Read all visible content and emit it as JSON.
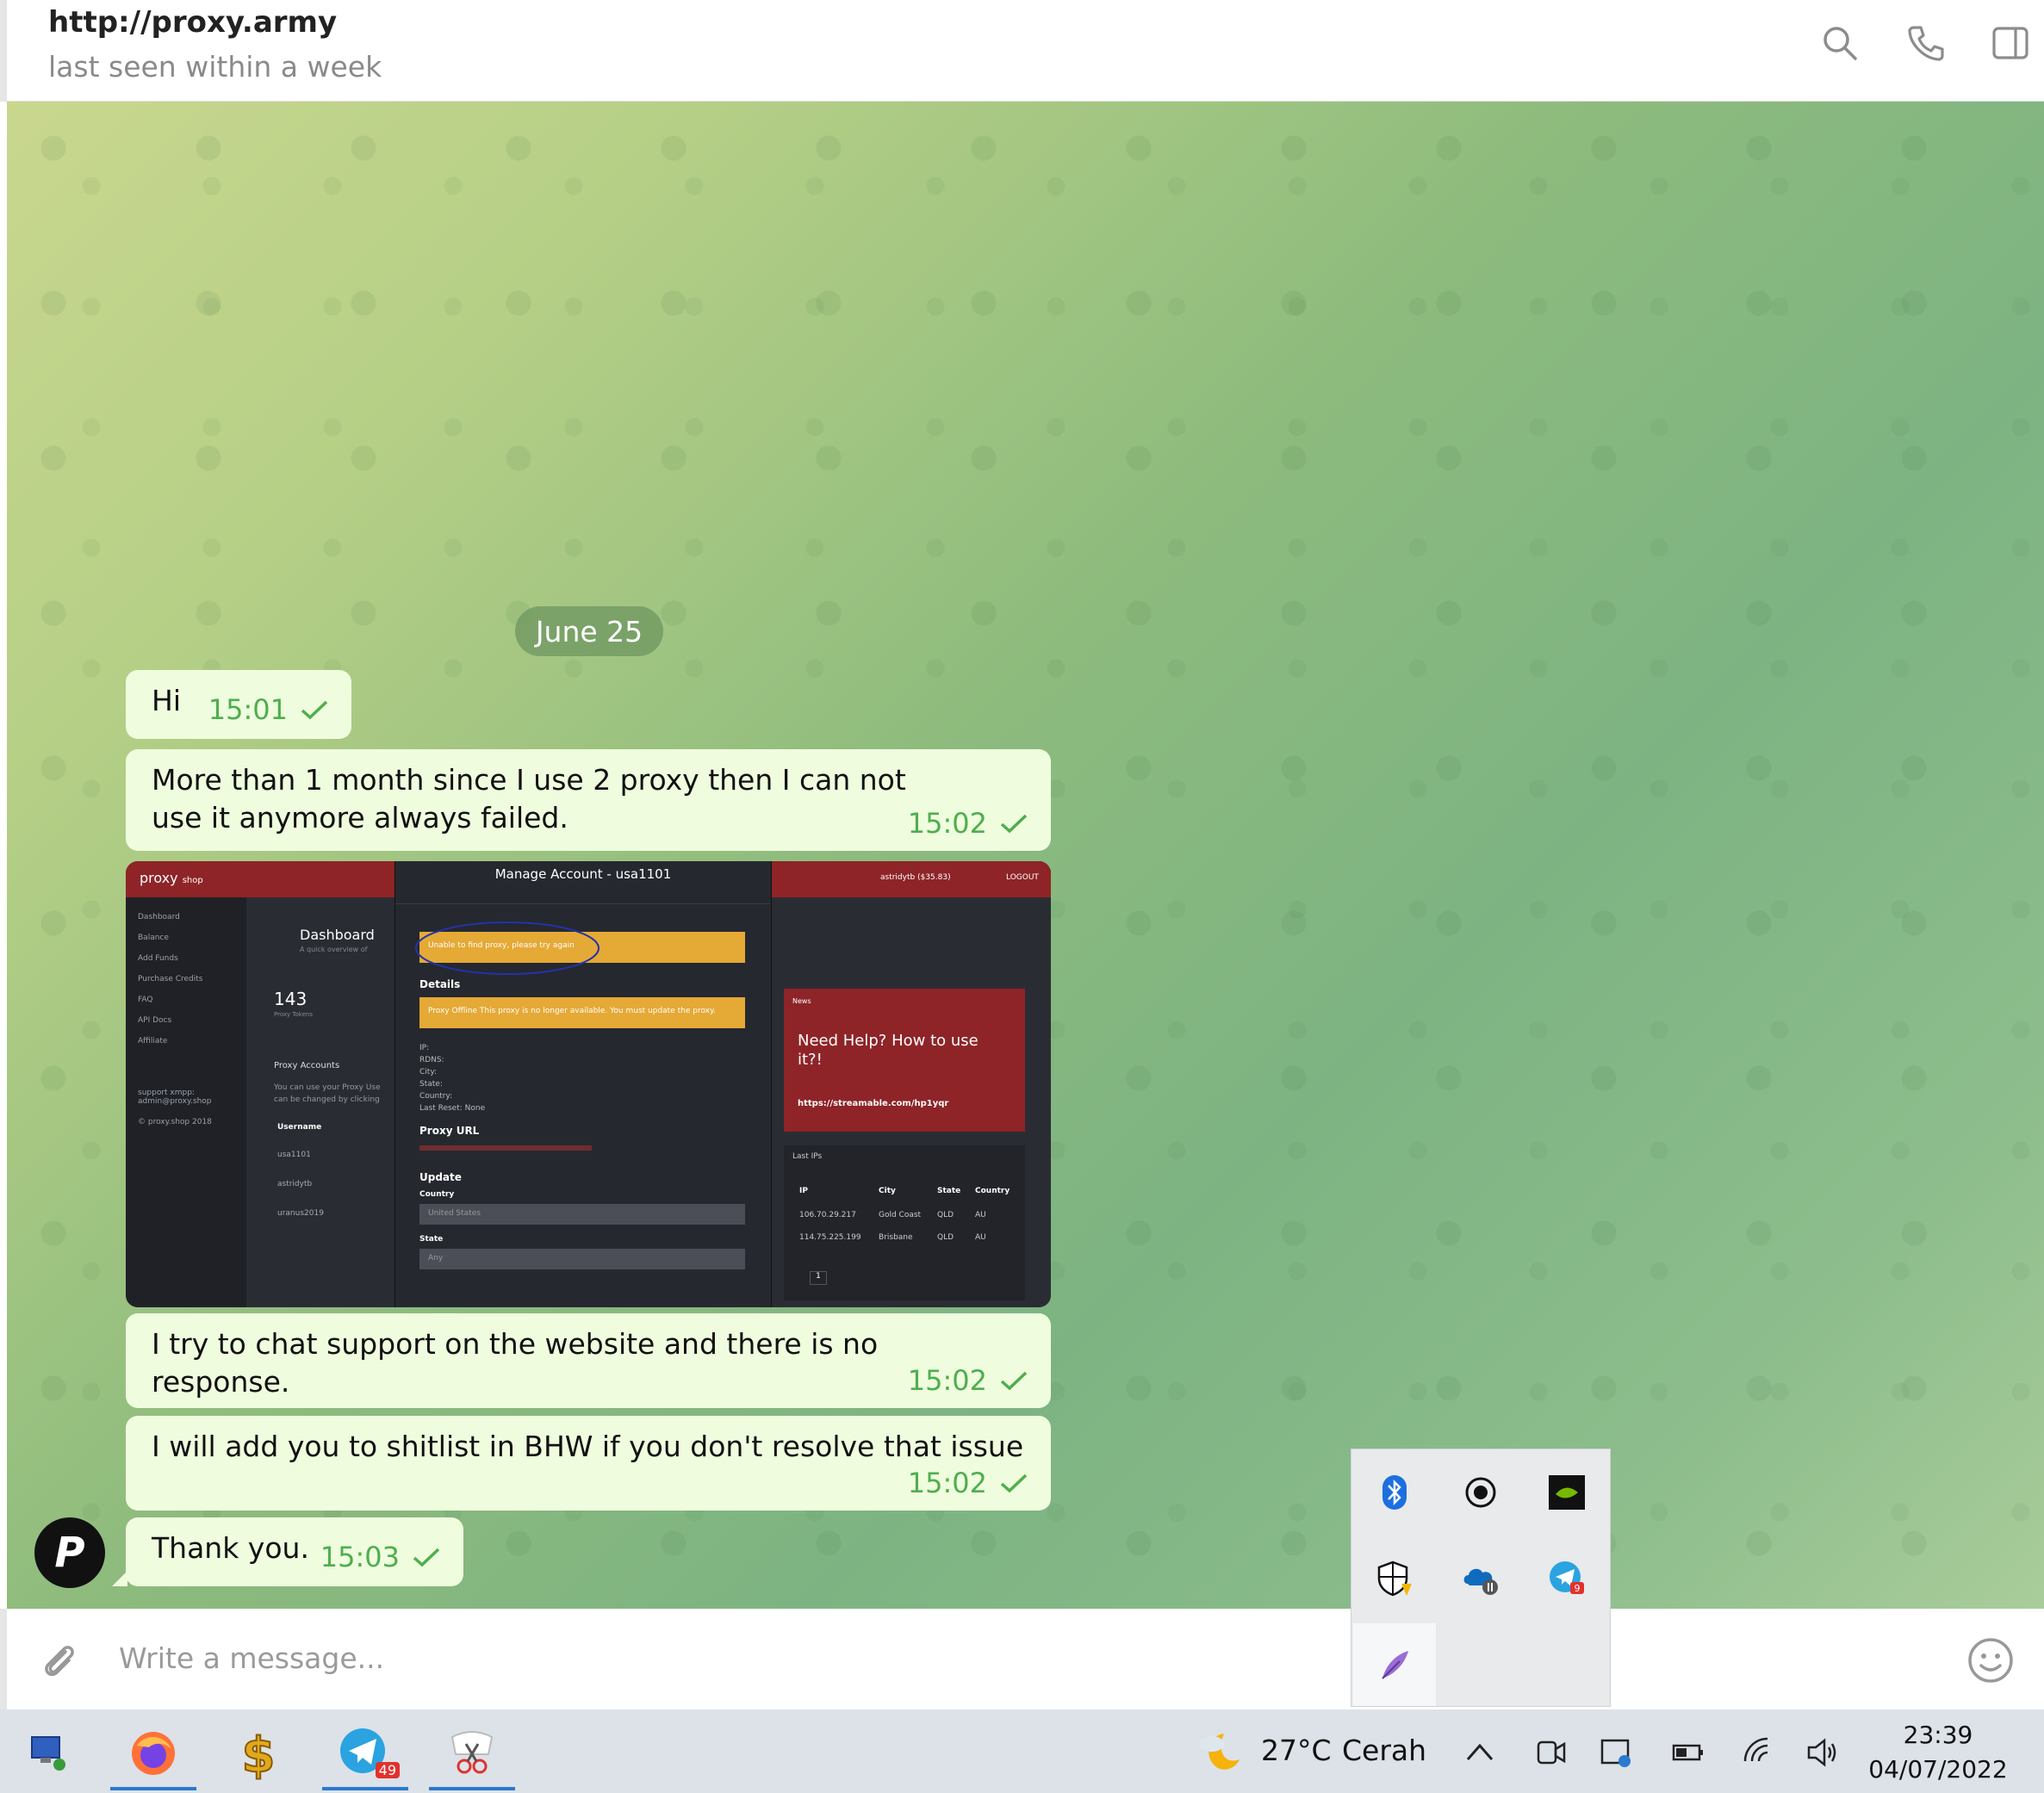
{
  "header": {
    "title": "http://proxy.army",
    "status": "last seen within a week",
    "icons": [
      "search-icon",
      "phone-icon",
      "sidebar-toggle-icon"
    ]
  },
  "chat": {
    "date_separator": "June 25",
    "messages": [
      {
        "text": "Hi",
        "time": "15:01"
      },
      {
        "text": "More than 1 month since I use 2 proxy then I can not use it anymore always failed.",
        "time": "15:02"
      },
      {
        "text": "I try to chat support on the website and there is no response.",
        "time": "15:02"
      },
      {
        "text": "I will add you to shitlist in BHW if you don't resolve that issue",
        "time": "15:02"
      },
      {
        "text": "Thank you.",
        "time": "15:03"
      }
    ],
    "avatar_letter": "P"
  },
  "screenshot": {
    "logo": "proxy",
    "logo_sub": "shop",
    "sidebar_items": [
      "Dashboard",
      "Balance",
      "Add Funds",
      "Purchase Credits",
      "FAQ",
      "API Docs",
      "Affiliate"
    ],
    "support_text": "support xmpp: admin@proxy.shop",
    "copyright": "© proxy.shop 2018",
    "dashboard_title": "Dashboard",
    "dashboard_sub": "A quick overview of",
    "tokens_count": "143",
    "tokens_label": "Proxy Tokens",
    "accounts_title": "Proxy Accounts",
    "accounts_desc": "You can use your Proxy Use can be changed by clicking",
    "username_header": "Username",
    "usernames": [
      "usa1101",
      "astridytb",
      "uranus2019"
    ],
    "modal_title": "Manage Account - usa1101",
    "alert1": "Unable to find proxy, please try again",
    "details_label": "Details",
    "alert2": "Proxy Offline This proxy is no longer available. You must update the proxy.",
    "detail_fields": "IP:\nRDNS:\nCity:\nState:\nCountry:\nLast Reset: None",
    "proxy_url_label": "Proxy URL",
    "update_label": "Update",
    "country_label": "Country",
    "country_value": "United States",
    "state_label": "State",
    "state_value": "Any",
    "account_info": "astridytb ($35.83)",
    "logout": "LOGOUT",
    "news_label": "News",
    "news_title": "Need Help? How to use it?!",
    "news_link": "https://streamable.com/hp1yqr",
    "last_ips_label": "Last IPs",
    "ip_headers": [
      "IP",
      "City",
      "State",
      "Country"
    ],
    "ip_rows": [
      [
        "106.70.29.217",
        "Gold Coast",
        "QLD",
        "AU"
      ],
      [
        "114.75.225.199",
        "Brisbane",
        "QLD",
        "AU"
      ]
    ],
    "pager": "1"
  },
  "composer": {
    "placeholder": "Write a message...",
    "icons": [
      "attach-icon",
      "emoji-icon"
    ]
  },
  "tray": {
    "items": [
      "bluetooth-icon",
      "record-icon",
      "nvidia-icon",
      "security-warning-icon",
      "onedrive-paused-icon",
      "telegram-tray-icon",
      "feather-icon"
    ],
    "telegram_badge": "9"
  },
  "taskbar": {
    "apps": [
      "network-computer-icon",
      "firefox-icon",
      "dollar-icon",
      "telegram-icon",
      "snipping-tool-icon"
    ],
    "telegram_badge": "49",
    "weather_temp": "27°C",
    "weather_desc": "Cerah",
    "time": "23:39",
    "date": "04/07/2022"
  },
  "colors": {
    "bubble": "#effdde",
    "meta_green": "#4fae4e",
    "taskbar": "#dce2e8"
  }
}
